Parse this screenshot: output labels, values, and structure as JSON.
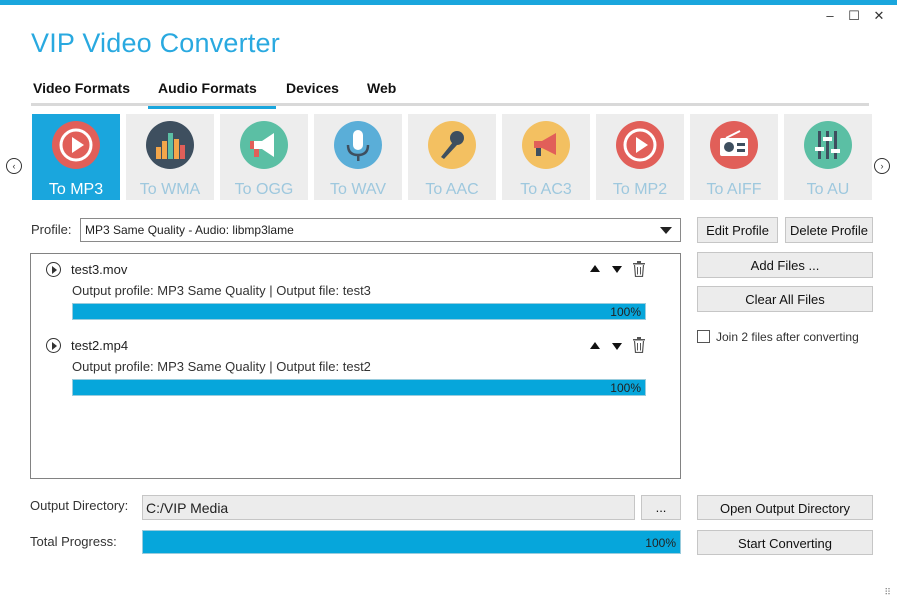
{
  "window": {
    "title": "VIP Video Converter",
    "controls": {
      "minimize": "–",
      "maximize": "☐",
      "close": "✕"
    }
  },
  "tabs": [
    {
      "label": "Video Formats",
      "active": false
    },
    {
      "label": "Audio Formats",
      "active": true
    },
    {
      "label": "Devices",
      "active": false
    },
    {
      "label": "Web",
      "active": false
    }
  ],
  "nav": {
    "prev": "‹",
    "next": "›"
  },
  "formats": [
    {
      "label": "To MP3",
      "icon": "play-icon",
      "color": "#e15f59",
      "active": true
    },
    {
      "label": "To WMA",
      "icon": "equalizer-icon",
      "color": "#3e4f5f",
      "active": false
    },
    {
      "label": "To OGG",
      "icon": "megaphone-icon",
      "color": "#5bbfa4",
      "active": false
    },
    {
      "label": "To WAV",
      "icon": "microphone-icon",
      "color": "#5aaed8",
      "active": false
    },
    {
      "label": "To AAC",
      "icon": "handheld-mic-icon",
      "color": "#f3c061",
      "active": false
    },
    {
      "label": "To AC3",
      "icon": "bullhorn-icon",
      "color": "#f3c061",
      "active": false
    },
    {
      "label": "To MP2",
      "icon": "play-icon",
      "color": "#e15f59",
      "active": false
    },
    {
      "label": "To AIFF",
      "icon": "radio-icon",
      "color": "#e15f59",
      "active": false
    },
    {
      "label": "To AU",
      "icon": "sliders-icon",
      "color": "#5bbfa4",
      "active": false
    }
  ],
  "profile": {
    "label": "Profile:",
    "value": "MP3 Same Quality - Audio: libmp3lame",
    "edit_label": "Edit Profile",
    "delete_label": "Delete Profile"
  },
  "actions": {
    "add_files": "Add Files ...",
    "clear_all": "Clear All Files",
    "join_label": "Join 2 files after converting",
    "join_checked": false
  },
  "files": [
    {
      "name": "test3.mov",
      "info": "Output profile:  MP3 Same Quality  |  Output file:  test3",
      "progress_text": "100%",
      "progress": 1.0
    },
    {
      "name": "test2.mp4",
      "info": "Output profile:  MP3 Same Quality  |  Output file:  test2",
      "progress_text": "100%",
      "progress": 1.0
    }
  ],
  "output": {
    "label": "Output Directory:",
    "value": "C:/VIP Media",
    "browse_label": "...",
    "open_label": "Open Output Directory"
  },
  "total": {
    "label": "Total Progress:",
    "progress_text": "100%",
    "progress": 1.0,
    "start_label": "Start Converting"
  },
  "colors": {
    "accent": "#1aa6dd",
    "progress": "#06a6db"
  }
}
